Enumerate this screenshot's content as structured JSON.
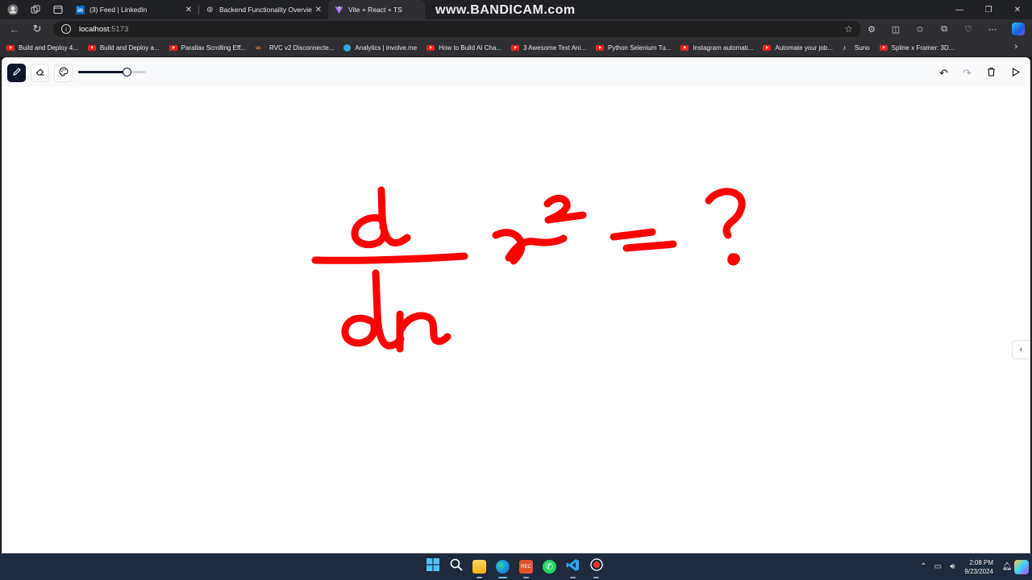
{
  "browser": {
    "tabs": [
      {
        "title": "(3) Feed | LinkedIn",
        "favicon": "linkedin-icon",
        "color": "#0a66c2"
      },
      {
        "title": "Backend Functionality Overview",
        "favicon": "openai-icon",
        "color": "#cfcfcf"
      },
      {
        "title": "Vite + React + TS",
        "favicon": "vite-icon",
        "color": "#bd34fe",
        "active": true
      }
    ],
    "watermark": "www.BANDICAM.com",
    "address": {
      "host": "localhost",
      "port": ":5173"
    },
    "bookmarks": [
      {
        "label": "Build and Deploy 4...",
        "icon": "youtube-icon"
      },
      {
        "label": "Build and Deploy a...",
        "icon": "youtube-icon"
      },
      {
        "label": "Parallax Scrolling Eff...",
        "icon": "youtube-icon"
      },
      {
        "label": "RVC v2 Disconnecte...",
        "icon": "colab-icon"
      },
      {
        "label": "Analytics | involve.me",
        "icon": "involveme-icon"
      },
      {
        "label": "How to Build AI Cha...",
        "icon": "youtube-icon"
      },
      {
        "label": "3 Awesome Text Ani...",
        "icon": "youtube-icon"
      },
      {
        "label": "Python Selenium Tu...",
        "icon": "youtube-icon"
      },
      {
        "label": "Instagram automati...",
        "icon": "youtube-icon"
      },
      {
        "label": "Automate your job...",
        "icon": "youtube-icon"
      },
      {
        "label": "Suno",
        "icon": "suno-icon"
      },
      {
        "label": "Spline x Framer: 3D...",
        "icon": "youtube-icon"
      }
    ]
  },
  "app": {
    "tools": [
      {
        "name": "pencil-tool",
        "icon": "pencil-icon",
        "selected": true
      },
      {
        "name": "eraser-tool",
        "icon": "eraser-icon",
        "selected": false
      },
      {
        "name": "color-palette-tool",
        "icon": "palette-icon",
        "selected": false
      }
    ],
    "brush_size_fraction": 0.72,
    "actions": [
      "undo-icon",
      "redo-icon",
      "trash-icon",
      "play-icon"
    ],
    "stroke_color": "#ff0000",
    "canvas_drawing": "d/dx x^2 = ?"
  },
  "taskbar": {
    "apps": [
      "windows-start-icon",
      "search-icon",
      "file-explorer-icon",
      "edge-icon",
      "bandicam-icon",
      "whatsapp-icon",
      "vscode-icon",
      "record-icon"
    ],
    "time": "2:08 PM",
    "date": "9/23/2024"
  }
}
